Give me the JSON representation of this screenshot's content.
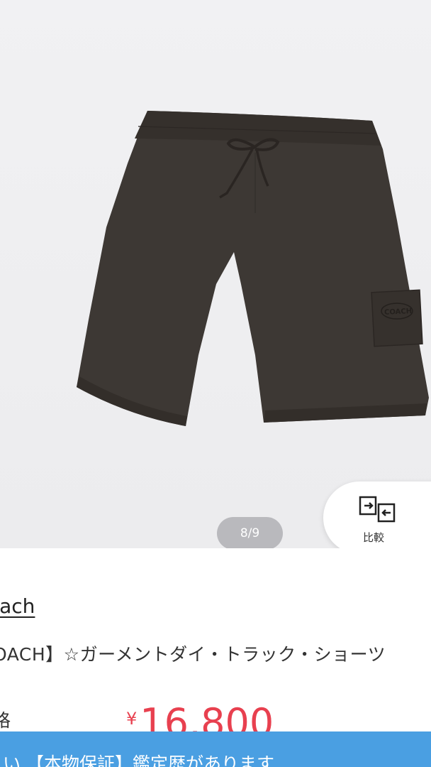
{
  "gallery": {
    "image_alt": "Dark brown garment-dyed track shorts",
    "page_indicator": "8/9",
    "compare_label": "比較"
  },
  "product": {
    "brand": "oach",
    "title": "OACH】☆ガーメントダイ・トラック・ショーツ",
    "price_label": "格",
    "currency": "¥",
    "price": "16,800"
  },
  "banner": {
    "text": "い 【本物保証】鑑定歴があります"
  },
  "colors": {
    "price_red": "#e8404f",
    "banner_blue": "#4a9fe2",
    "shorts_brown": "#3d3834"
  }
}
